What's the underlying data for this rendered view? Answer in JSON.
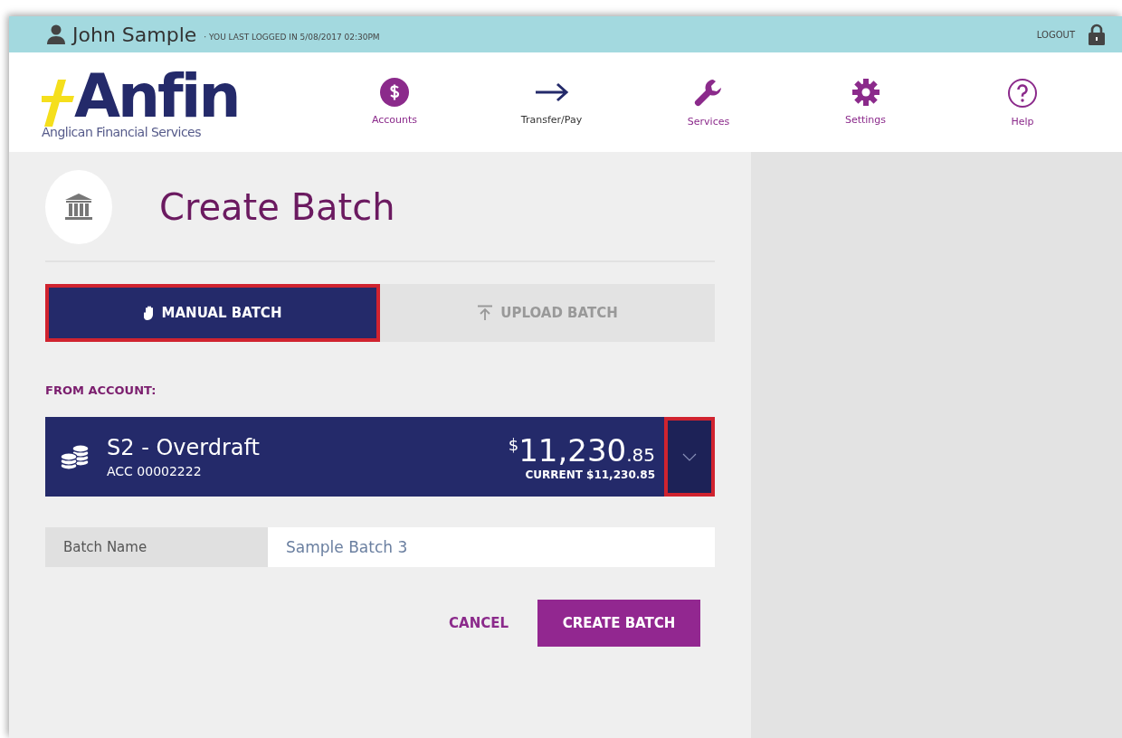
{
  "top_bar": {
    "user_name": "John Sample",
    "last_login": "· YOU LAST LOGGED IN 5/08/2017 02:30PM",
    "logout": "LOGOUT"
  },
  "logo": {
    "wordmark": "Anfin",
    "tagline": "Anglican Financial Services"
  },
  "nav": [
    {
      "kind": "dollar",
      "label": "Accounts"
    },
    {
      "kind": "arrow",
      "label": "Transfer/Pay"
    },
    {
      "kind": "wrench",
      "label": "Services"
    },
    {
      "kind": "gear",
      "label": "Settings"
    },
    {
      "kind": "help",
      "label": "Help"
    }
  ],
  "page_title": "Create Batch",
  "tabs": [
    {
      "kind": "hand",
      "label": "MANUAL BATCH",
      "selected": true,
      "highlighted": true
    },
    {
      "kind": "upload",
      "label": "UPLOAD BATCH",
      "selected": false,
      "highlighted": false
    }
  ],
  "from_account": {
    "label": "FROM ACCOUNT:",
    "name": "S2 - Overdraft",
    "number": "ACC 00002222",
    "currency": "$",
    "amount": "11,230",
    "cents": ".85",
    "current": "CURRENT $11,230.85",
    "dropdown_highlighted": true
  },
  "batch_name": {
    "label": "Batch Name",
    "value": "Sample Batch 3"
  },
  "buttons": {
    "cancel": "CANCEL",
    "create": "CREATE BATCH"
  }
}
